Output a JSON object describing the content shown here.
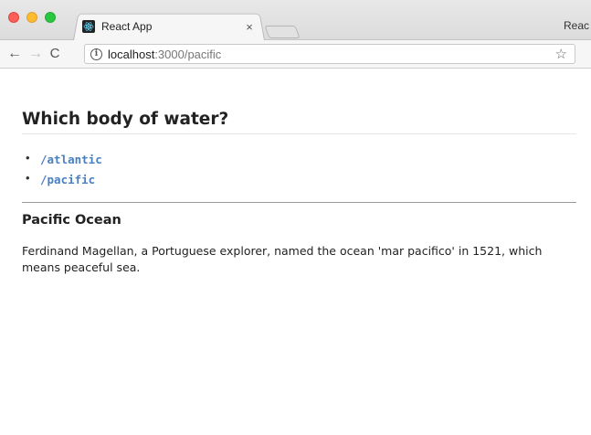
{
  "browser": {
    "tab_title": "React App",
    "tab_close": "×",
    "profile_text": "Reac",
    "url_host": "localhost",
    "url_rest": ":3000/pacific",
    "star_glyph": "☆",
    "menu_glyph": "⋮",
    "back_glyph": "←",
    "forward_glyph": "→",
    "reload_glyph": "C"
  },
  "page": {
    "title": "Which body of water?",
    "links": [
      {
        "label": "/atlantic"
      },
      {
        "label": "/pacific"
      }
    ],
    "section": {
      "heading": "Pacific Ocean",
      "description": "Ferdinand Magellan, a Portuguese explorer, named the ocean 'mar pacifico' in 1521, which means peaceful sea."
    }
  }
}
